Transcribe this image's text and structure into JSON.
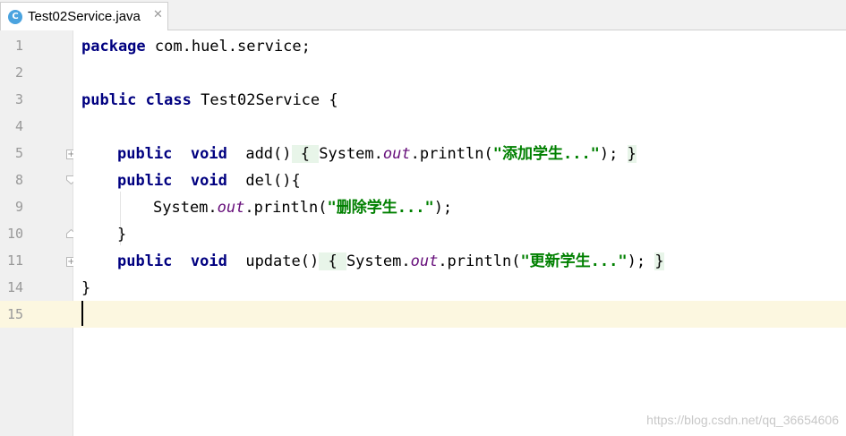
{
  "tab": {
    "label": "Test02Service.java",
    "icon_letter": "C",
    "close_glyph": "✕"
  },
  "line_numbers": [
    "1",
    "2",
    "3",
    "4",
    "5",
    "8",
    "9",
    "10",
    "11",
    "14",
    "15"
  ],
  "code": {
    "l1_kw": "package",
    "l1_rest": " com.huel.service;",
    "l3_kw1": "public",
    "l3_kw2": "class",
    "l3_rest": " Test02Service {",
    "l5_kw1": "public",
    "l5_kw2": "void",
    "l5_name": "  add()",
    "l5_open": " { ",
    "l5_sys": "System.",
    "l5_out": "out",
    "l5_print": ".println(",
    "l5_str": "\"添加学生...\"",
    "l5_end": "); ",
    "l5_close": "}",
    "l8_kw1": "public",
    "l8_kw2": "void",
    "l8_rest": "  del(){",
    "l9_sys": "System.",
    "l9_out": "out",
    "l9_print": ".println(",
    "l9_str": "\"删除学生...\"",
    "l9_end": ");",
    "l10": "}",
    "l11_kw1": "public",
    "l11_kw2": "void",
    "l11_name": "  update()",
    "l11_open": " { ",
    "l11_sys": "System.",
    "l11_out": "out",
    "l11_print": ".println(",
    "l11_str": "\"更新学生...\"",
    "l11_end": "); ",
    "l11_close": "}",
    "l14": "}"
  },
  "watermark": "https://blog.csdn.net/qq_36654606",
  "colors": {
    "keyword": "#000080",
    "string": "#008000",
    "field": "#660e7a",
    "current_line": "#fcf7e0"
  }
}
